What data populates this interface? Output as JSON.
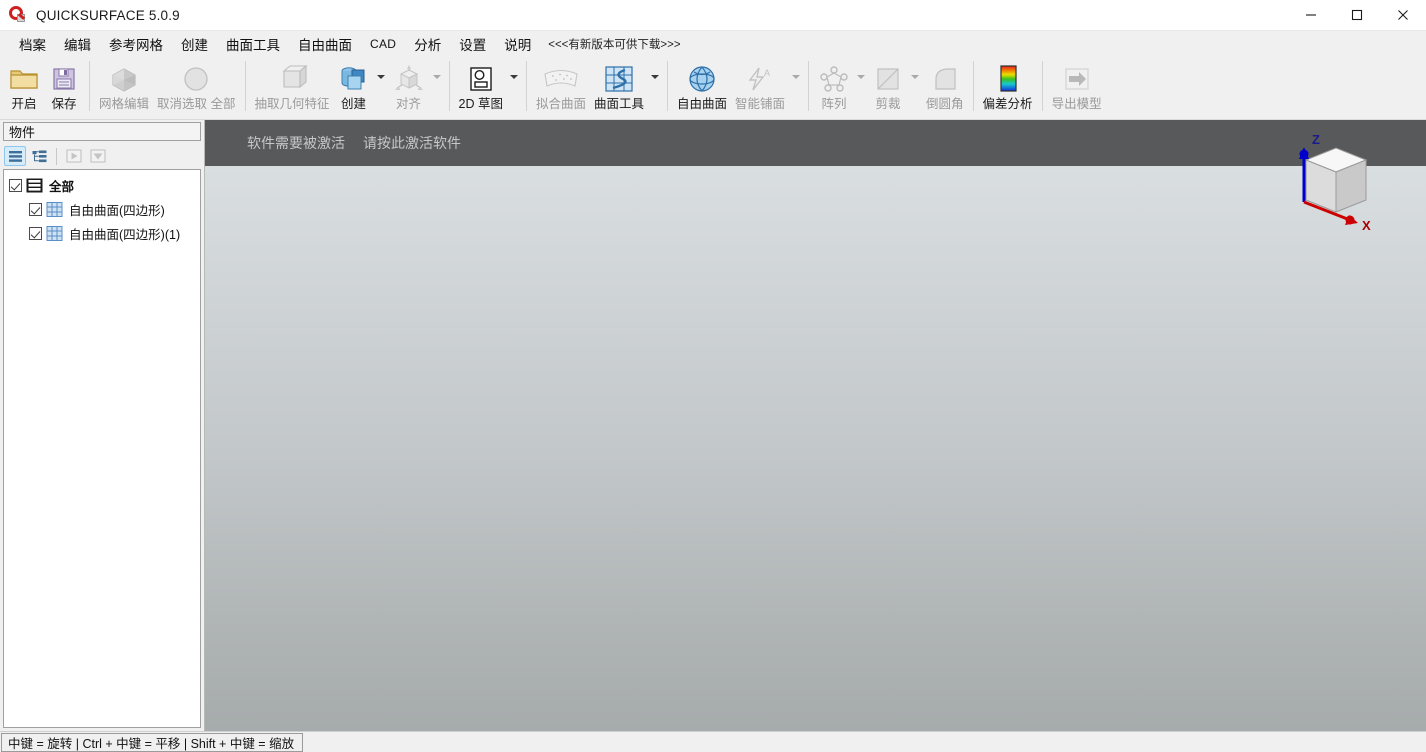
{
  "window": {
    "title": "QUICKSURFACE 5.0.9",
    "app_icon": "quicksurface-logo-icon",
    "minimize_label": "—",
    "maximize_label": "□",
    "close_label": "✕"
  },
  "menubar": {
    "items": [
      {
        "label": "档案",
        "name": "menu-file"
      },
      {
        "label": "编辑",
        "name": "menu-edit"
      },
      {
        "label": "参考网格",
        "name": "menu-reference-mesh"
      },
      {
        "label": "创建",
        "name": "menu-create"
      },
      {
        "label": "曲面工具",
        "name": "menu-surface-tools"
      },
      {
        "label": "自由曲面",
        "name": "menu-freeform-surface"
      },
      {
        "label": "CAD",
        "name": "menu-cad"
      },
      {
        "label": "分析",
        "name": "menu-analysis"
      },
      {
        "label": "设置",
        "name": "menu-settings"
      },
      {
        "label": "说明",
        "name": "menu-help"
      }
    ],
    "notice": "<<<有新版本可供下载>>>"
  },
  "ribbon": {
    "groups": [
      {
        "name": "file-group",
        "tools": [
          {
            "label": "开启",
            "name": "open-button",
            "icon": "folder-icon",
            "disabled": false,
            "dropdown": false
          },
          {
            "label": "保存",
            "name": "save-button",
            "icon": "floppy-disk-icon",
            "disabled": false,
            "dropdown": false
          }
        ]
      },
      {
        "name": "mesh-group",
        "tools": [
          {
            "label": "网格编辑",
            "name": "mesh-edit-button",
            "icon": "hexagon-mesh-icon",
            "disabled": true,
            "dropdown": false
          },
          {
            "label": "取消选取 全部",
            "name": "deselect-all-button",
            "icon": "circle-icon",
            "disabled": true,
            "dropdown": false
          }
        ]
      },
      {
        "name": "geometry-group",
        "tools": [
          {
            "label": "抽取几何特征",
            "name": "extract-geometry-feature-button",
            "icon": "cube-wire-icon",
            "disabled": true,
            "dropdown": false
          },
          {
            "label": "创建",
            "name": "create-button",
            "icon": "cylinder-cube-icon",
            "disabled": false,
            "dropdown": true
          },
          {
            "label": "对齐",
            "name": "align-button",
            "icon": "align-cube-icon",
            "disabled": true,
            "dropdown": true
          }
        ]
      },
      {
        "name": "sketch-group",
        "tools": [
          {
            "label": "2D 草图",
            "name": "sketch-2d-button",
            "icon": "sketch-2d-icon",
            "disabled": false,
            "dropdown": true
          }
        ]
      },
      {
        "name": "surface-group",
        "tools": [
          {
            "label": "拟合曲面",
            "name": "fit-surface-button",
            "icon": "fit-surface-icon",
            "disabled": true,
            "dropdown": false
          },
          {
            "label": "曲面工具",
            "name": "surface-tools-button",
            "icon": "surface-grid-icon",
            "disabled": false,
            "dropdown": true
          }
        ]
      },
      {
        "name": "freeform-group",
        "tools": [
          {
            "label": "自由曲面",
            "name": "freeform-surface-button",
            "icon": "torus-sphere-icon",
            "disabled": false,
            "dropdown": false
          },
          {
            "label": "智能铺面",
            "name": "smart-surfacing-button",
            "icon": "lightning-auto-icon",
            "disabled": true,
            "dropdown": true
          }
        ]
      },
      {
        "name": "edit-group",
        "tools": [
          {
            "label": "阵列",
            "name": "array-button",
            "icon": "pattern-array-icon",
            "disabled": true,
            "dropdown": true
          },
          {
            "label": "剪裁",
            "name": "trim-button",
            "icon": "trim-icon",
            "disabled": true,
            "dropdown": true
          },
          {
            "label": "倒圆角",
            "name": "fillet-button",
            "icon": "fillet-icon",
            "disabled": true,
            "dropdown": false
          }
        ]
      },
      {
        "name": "analysis-group",
        "tools": [
          {
            "label": "偏差分析",
            "name": "deviation-analysis-button",
            "icon": "rainbow-gradient-icon",
            "disabled": false,
            "dropdown": false
          }
        ]
      },
      {
        "name": "export-group",
        "tools": [
          {
            "label": "导出模型",
            "name": "export-model-button",
            "icon": "export-arrow-icon",
            "disabled": true,
            "dropdown": false
          }
        ]
      }
    ]
  },
  "sidebar": {
    "header": "物件",
    "toolbar": [
      {
        "name": "list-view-button",
        "icon": "list-view-icon",
        "active": true
      },
      {
        "name": "tree-view-button",
        "icon": "tree-view-icon",
        "active": false
      },
      {
        "name": "play-button",
        "icon": "play-triangle-icon",
        "active": false,
        "disabled": true
      },
      {
        "name": "filter-button",
        "icon": "filter-triangle-icon",
        "active": false,
        "disabled": true
      }
    ],
    "tree": [
      {
        "label": "全部",
        "name": "tree-item-all",
        "icon": "layers-icon",
        "checked": true,
        "bold": true,
        "level": 0
      },
      {
        "label": "自由曲面(四边形)",
        "name": "tree-item-freeform-surface-quad",
        "icon": "grid-surface-icon",
        "checked": true,
        "bold": false,
        "level": 1
      },
      {
        "label": "自由曲面(四边形)(1)",
        "name": "tree-item-freeform-surface-quad-1",
        "icon": "grid-surface-icon",
        "checked": true,
        "bold": false,
        "level": 1
      }
    ]
  },
  "viewport": {
    "activation_message_1": "软件需要被激活",
    "activation_message_2": "请按此激活软件",
    "viewcube": {
      "z_axis_label": "Z",
      "x_axis_label": "X",
      "z_axis_color": "#0000cc",
      "x_axis_color": "#cc0000"
    }
  },
  "statusbar": {
    "hint": "中键 = 旋转 | Ctrl + 中键 = 平移 | Shift + 中键 = 缩放"
  },
  "colors": {
    "activation_bar": "#58595a",
    "panel_bg": "#f0f0f0",
    "accent_blue": "#5b9bd5",
    "viewport_top": "#dde2e4",
    "viewport_bottom": "#a6abac"
  }
}
